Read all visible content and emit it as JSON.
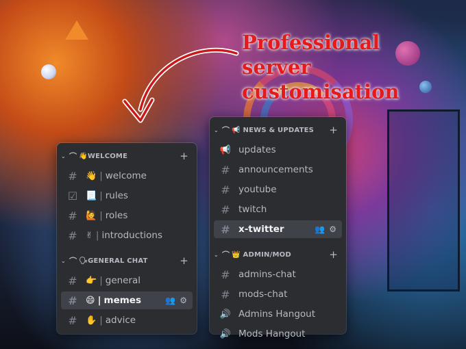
{
  "headline": {
    "line1": "Professional",
    "line2": "server",
    "line3": "customisation"
  },
  "icons": {
    "hash": "#",
    "rules": "☑",
    "megaphone": "📢",
    "speaker": "🔊",
    "chevron": "⌄",
    "tilde": "⌒",
    "plus": "+",
    "add_user": "👥",
    "gear": "⚙",
    "separator": "|"
  },
  "left_panel": {
    "categories": [
      {
        "name": "👋WELCOME",
        "channels": [
          {
            "emoji": "👋",
            "name": "welcome",
            "icon": "hash"
          },
          {
            "emoji": "📃",
            "name": "rules",
            "icon": "rules"
          },
          {
            "emoji": "🙋",
            "name": "roles",
            "icon": "hash"
          },
          {
            "emoji": "✌",
            "name": "introductions",
            "icon": "hash"
          }
        ]
      },
      {
        "name": "🗣GENERAL CHAT",
        "channels": [
          {
            "emoji": "👉",
            "name": "general",
            "icon": "hash"
          },
          {
            "emoji": "😄",
            "name": "memes",
            "icon": "hash",
            "active": true
          },
          {
            "emoji": "✋",
            "name": "advice",
            "icon": "hash"
          }
        ]
      }
    ]
  },
  "right_panel": {
    "categories": [
      {
        "name": "📢 NEWS & UPDATES",
        "channels": [
          {
            "name": "updates",
            "icon": "megaphone"
          },
          {
            "name": "announcements",
            "icon": "hash"
          },
          {
            "name": "youtube",
            "icon": "hash"
          },
          {
            "name": "twitch",
            "icon": "hash"
          },
          {
            "name": "x-twitter",
            "icon": "hash",
            "active": true
          }
        ]
      },
      {
        "name": "👑 ADMIN/MOD",
        "channels": [
          {
            "name": "admins-chat",
            "icon": "hash"
          },
          {
            "name": "mods-chat",
            "icon": "hash"
          },
          {
            "name": "Admins Hangout",
            "icon": "speaker"
          },
          {
            "name": "Mods Hangout",
            "icon": "speaker"
          }
        ]
      }
    ]
  },
  "colors": {
    "panel_bg": "#2b2d31",
    "active_bg": "#404249",
    "text_muted": "#b5bac1",
    "headline": "#e31b1b"
  }
}
